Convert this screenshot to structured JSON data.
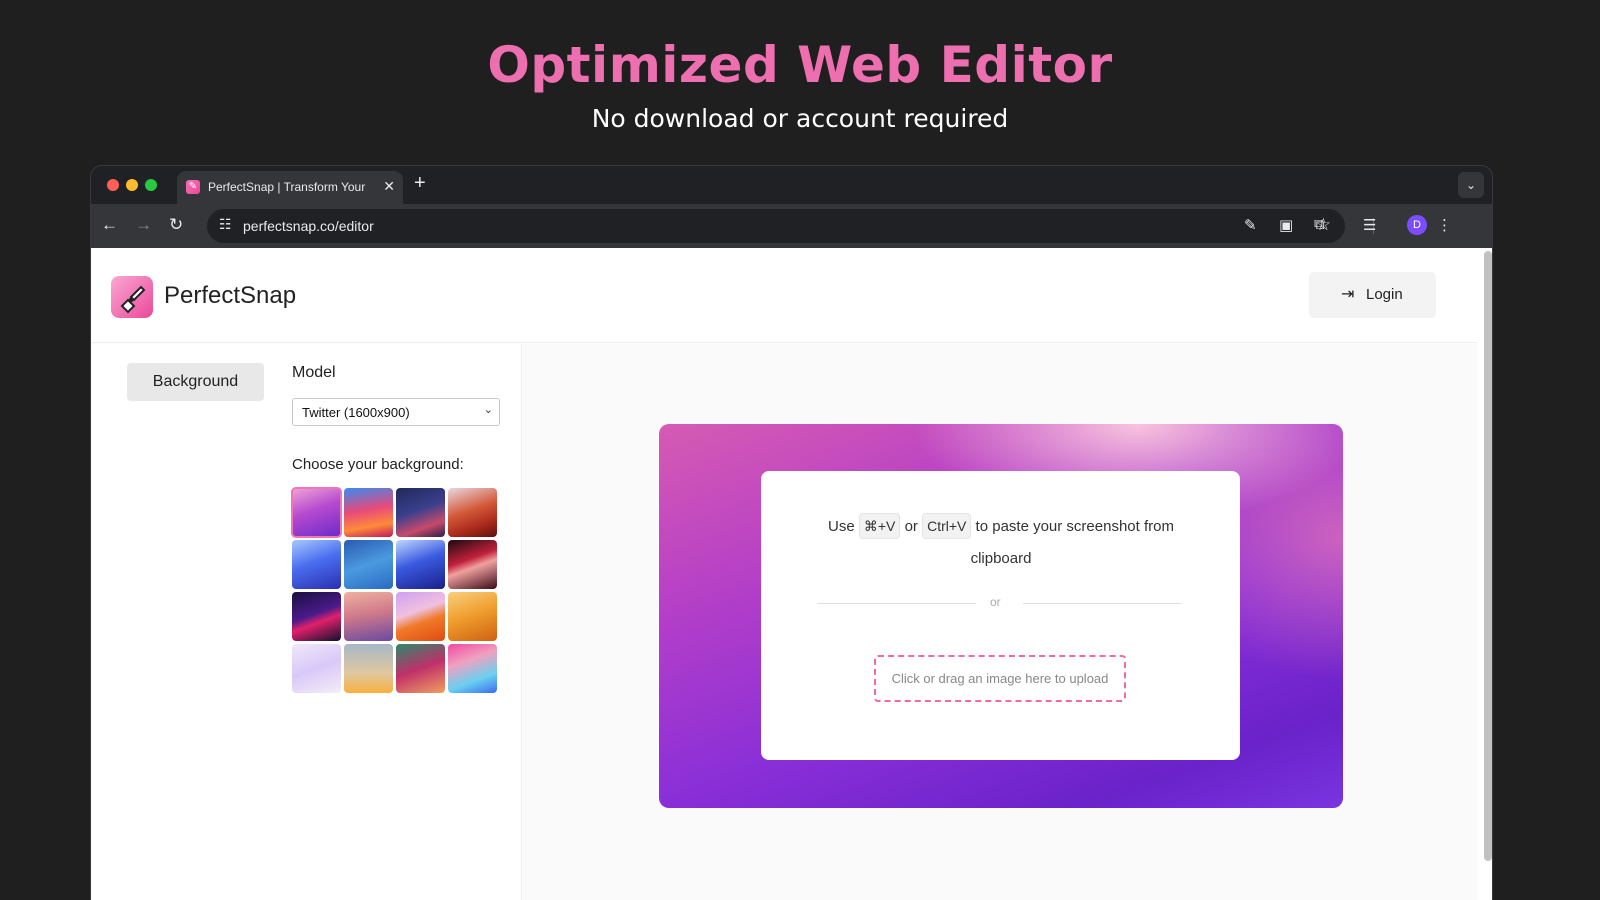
{
  "hero": {
    "title": "Optimized Web Editor",
    "subtitle": "No download or account required"
  },
  "browser": {
    "tab_title": "PerfectSnap | Transform Your",
    "url": "perfectsnap.co/editor",
    "profile_initial": "D"
  },
  "app": {
    "brand": "PerfectSnap",
    "login_label": "Login",
    "sidebar": {
      "background_button": "Background",
      "model_label": "Model",
      "model_selected": "Twitter (1600x900)",
      "choose_label": "Choose your background:"
    },
    "upload": {
      "use_word": "Use",
      "mac_shortcut": "⌘+V",
      "or_word": "or",
      "win_shortcut": "Ctrl+V",
      "paste_rest": "to paste your screenshot from clipboard",
      "divider_text": "or",
      "dropzone_text": "Click or drag an image here to upload"
    }
  },
  "colors": {
    "accent_pink": "#ee6fb0",
    "page_bg": "#1f1f1f",
    "dropzone_border": "#f06aa9"
  }
}
